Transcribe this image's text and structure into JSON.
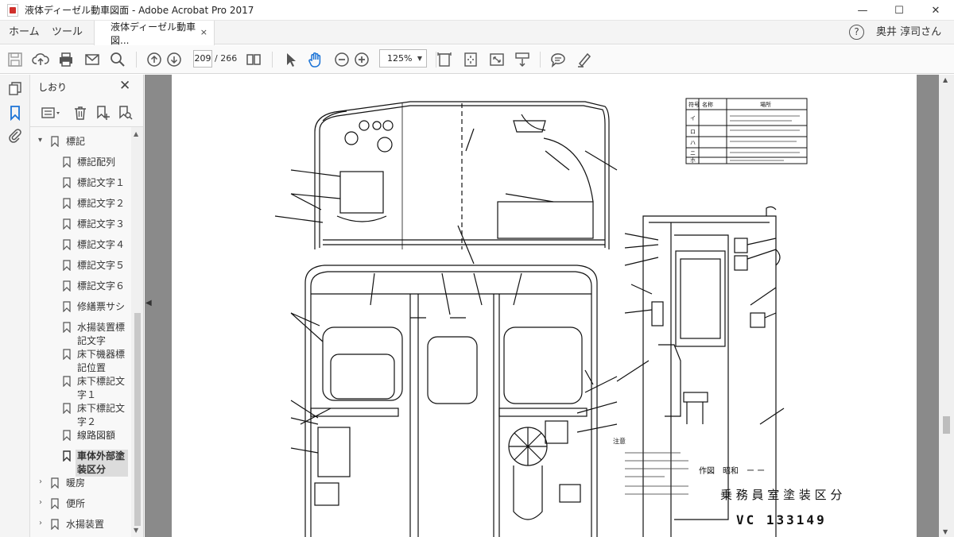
{
  "window": {
    "title": "液体ディーゼル動車図面 - Adobe Acrobat Pro 2017",
    "controls": {
      "minimize": "—",
      "maximize": "☐",
      "close": "✕"
    }
  },
  "menubar": {
    "home": "ホーム",
    "tools": "ツール",
    "doc_tab": "液体ディーゼル動車図...",
    "doc_tab_close": "×",
    "help": "?",
    "user": "奥井 淳司さん"
  },
  "toolbar": {
    "page_current": "209",
    "page_total": "/ 266",
    "zoom": "125%"
  },
  "bookmarks": {
    "title": "しおり",
    "close": "✕",
    "items": [
      {
        "label": "標記",
        "level": 0,
        "expanded": true
      },
      {
        "label": "標記配列",
        "level": 1
      },
      {
        "label": "標記文字１",
        "level": 1
      },
      {
        "label": "標記文字２",
        "level": 1
      },
      {
        "label": "標記文字３",
        "level": 1
      },
      {
        "label": "標記文字４",
        "level": 1
      },
      {
        "label": "標記文字５",
        "level": 1
      },
      {
        "label": "標記文字６",
        "level": 1
      },
      {
        "label": "修繕票サシ",
        "level": 1
      },
      {
        "label": "水揚装置標記文字",
        "level": 1
      },
      {
        "label": "床下機器標記位置",
        "level": 1
      },
      {
        "label": "床下標記文字１",
        "level": 1
      },
      {
        "label": "床下標記文字２",
        "level": 1
      },
      {
        "label": "線路図額",
        "level": 1
      },
      {
        "label": "車体外部塗装区分",
        "level": 1,
        "selected": true
      },
      {
        "label": "暖房",
        "level": 0,
        "expanded": false
      },
      {
        "label": "便所",
        "level": 0,
        "expanded": false
      },
      {
        "label": "水揚装置",
        "level": 0,
        "expanded": false
      }
    ]
  },
  "drawing": {
    "sakuzu": "作図　昭和　ー ー",
    "title": "乗 務 員 室 塗 装 区 分",
    "number": "VC 133149",
    "legend_header": [
      "符号",
      "名称",
      "場所"
    ],
    "legend_rows": [
      "イ",
      "ロ",
      "ハ",
      "ニ",
      "ホ"
    ],
    "notes_header": "注意"
  }
}
